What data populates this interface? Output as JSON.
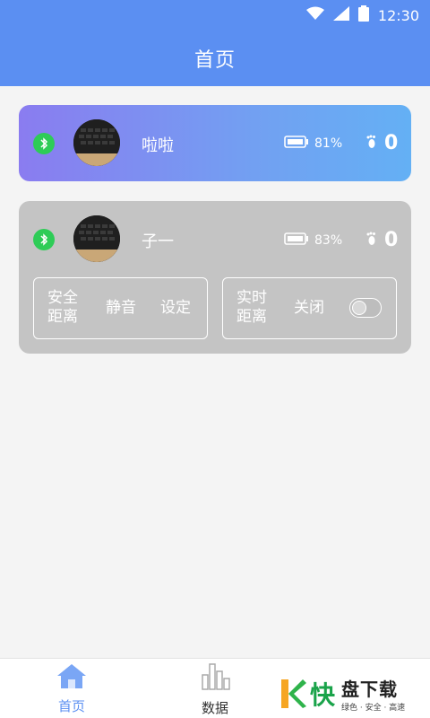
{
  "status_bar": {
    "time": "12:30",
    "icons": [
      "wifi-icon",
      "signal-icon",
      "battery-icon"
    ]
  },
  "app_bar": {
    "title": "首页"
  },
  "devices": [
    {
      "name": "啦啦",
      "battery": "81%",
      "steps": "0",
      "connected": true
    },
    {
      "name": "子一",
      "battery": "83%",
      "steps": "0",
      "connected": true,
      "options": {
        "safe_distance": "安全\n距离",
        "mute": "静音",
        "settings": "设定",
        "realtime_distance": "实时\n距离",
        "off": "关闭",
        "toggle_on": false
      }
    }
  ],
  "tabs": [
    {
      "label": "首页",
      "icon": "home-icon",
      "active": true
    },
    {
      "label": "数据",
      "icon": "bar-chart-icon",
      "active": false
    }
  ],
  "watermark": {
    "main": "快",
    "right_top": "盘下载",
    "right_bottom": "绿色 · 安全 · 高速"
  },
  "colors": {
    "primary": "#5b8ff2",
    "bt_green": "#2ecc57",
    "card_gray": "#c4c4c4"
  }
}
